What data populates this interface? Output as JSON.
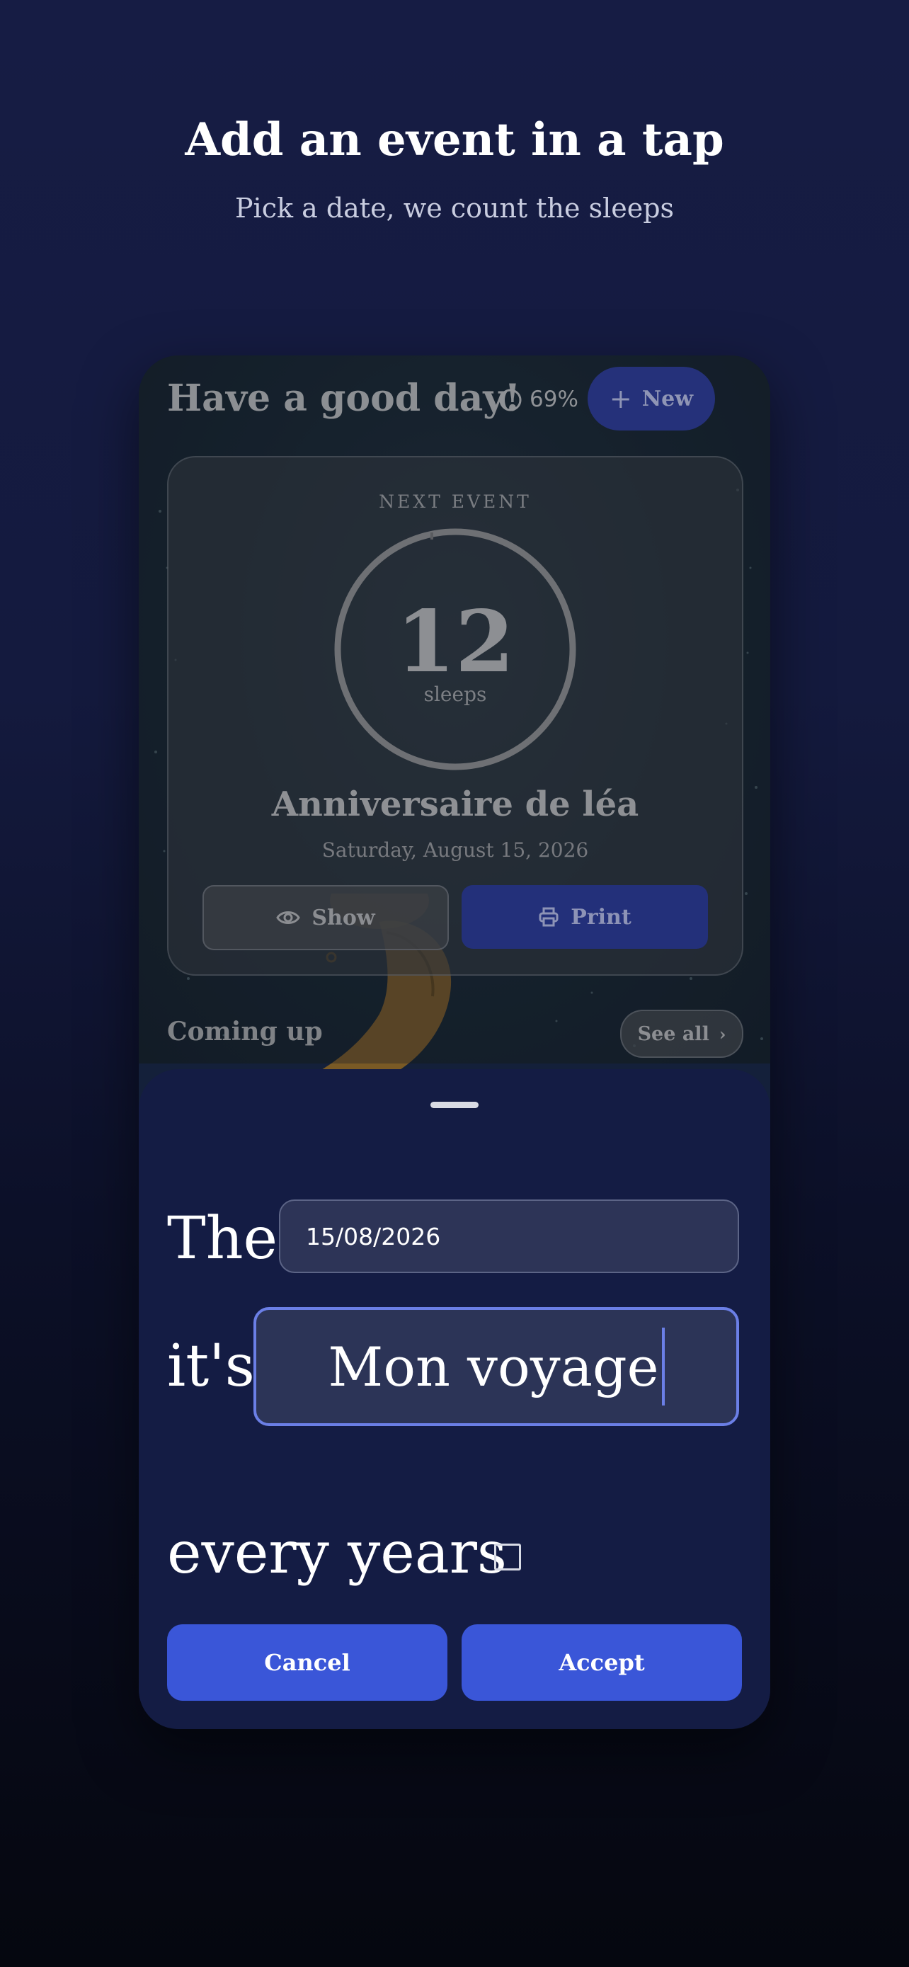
{
  "promo": {
    "title": "Add an event in a tap",
    "subtitle": "Pick a date, we count the sleeps"
  },
  "header": {
    "greeting": "Have a good day!",
    "moon_percent": "69%",
    "moon_icon": "moon-phase-icon",
    "new_button": "New"
  },
  "next_event": {
    "label": "NEXT EVENT",
    "count": "12",
    "unit": "sleeps",
    "title": "Anniversaire de léa",
    "date": "Saturday, August 15, 2026",
    "show_button": "Show",
    "print_button": "Print"
  },
  "coming_up": {
    "title": "Coming up",
    "see_all": "See all"
  },
  "sheet": {
    "the_label": "The",
    "date_value": "15/08/2026",
    "its_label": "it's",
    "name_value": "Mon voyage",
    "repeat_label": "every years",
    "repeat_checked": false,
    "cancel": "Cancel",
    "accept": "Accept"
  },
  "colors": {
    "accent": "#3a56d8",
    "sheet_bg": "#141c44",
    "focus_border": "#6b7fe6"
  }
}
